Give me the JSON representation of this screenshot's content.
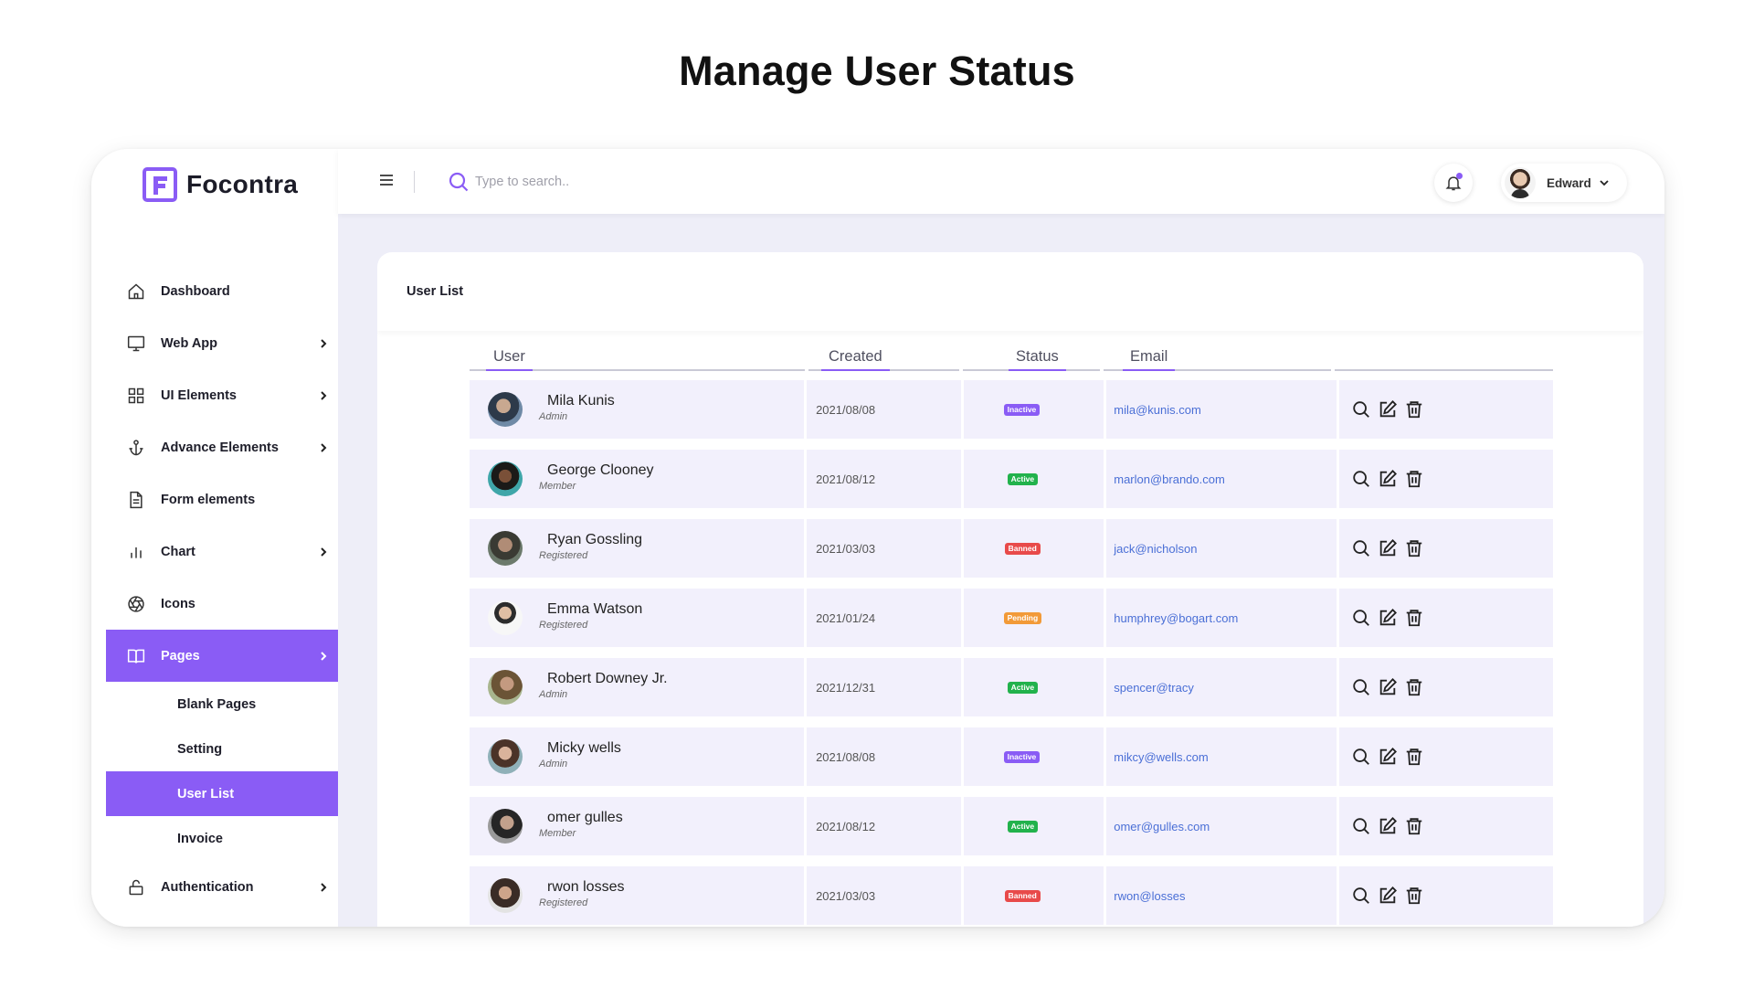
{
  "page_title": "Manage User Status",
  "brand": {
    "name": "Focontra"
  },
  "colors": {
    "accent": "#8a5cf5",
    "content_bg": "#eeeef8",
    "row_bg": "#f2f0fc",
    "link": "#4a6fd6"
  },
  "sidebar": {
    "items": [
      {
        "label": "Dashboard",
        "icon": "home-icon",
        "chevron": false
      },
      {
        "label": "Web App",
        "icon": "monitor-icon",
        "chevron": true
      },
      {
        "label": "UI Elements",
        "icon": "grid-icon",
        "chevron": true
      },
      {
        "label": "Advance Elements",
        "icon": "anchor-icon",
        "chevron": true
      },
      {
        "label": "Form elements",
        "icon": "document-icon",
        "chevron": false
      },
      {
        "label": "Chart",
        "icon": "bar-chart-icon",
        "chevron": true
      },
      {
        "label": "Icons",
        "icon": "aperture-icon",
        "chevron": false
      },
      {
        "label": "Pages",
        "icon": "book-icon",
        "chevron": true,
        "active": true
      }
    ],
    "sub_items": [
      {
        "label": "Blank Pages"
      },
      {
        "label": "Setting"
      },
      {
        "label": "User List",
        "active": true
      },
      {
        "label": "Invoice"
      }
    ],
    "bottom_item": {
      "label": "Authentication",
      "icon": "lock-icon",
      "chevron": true
    }
  },
  "topbar": {
    "search_placeholder": "Type to search..",
    "user_name": "Edward"
  },
  "card": {
    "title": "User List"
  },
  "table": {
    "headers": {
      "user": "User",
      "created": "Created",
      "status": "Status",
      "email": "Email"
    },
    "status_colors": {
      "Inactive": "#8a5cf5",
      "Active": "#22b24c",
      "Banned": "#e84a4a",
      "Pending": "#f29a38"
    },
    "rows": [
      {
        "name": "Mila Kunis",
        "role": "Admin",
        "created": "2021/08/08",
        "status": "Inactive",
        "email": "mila@kunis.com"
      },
      {
        "name": "George Clooney",
        "role": "Member",
        "created": "2021/08/12",
        "status": "Active",
        "email": "marlon@brando.com"
      },
      {
        "name": "Ryan Gossling",
        "role": "Registered",
        "created": "2021/03/03",
        "status": "Banned",
        "email": "jack@nicholson"
      },
      {
        "name": "Emma Watson",
        "role": "Registered",
        "created": "2021/01/24",
        "status": "Pending",
        "email": "humphrey@bogart.com"
      },
      {
        "name": "Robert Downey Jr.",
        "role": "Admin",
        "created": "2021/12/31",
        "status": "Active",
        "email": "spencer@tracy"
      },
      {
        "name": "Micky wells",
        "role": "Admin",
        "created": "2021/08/08",
        "status": "Inactive",
        "email": "mikcy@wells.com"
      },
      {
        "name": "omer gulles",
        "role": "Member",
        "created": "2021/08/12",
        "status": "Active",
        "email": "omer@gulles.com"
      },
      {
        "name": "rwon losses",
        "role": "Registered",
        "created": "2021/03/03",
        "status": "Banned",
        "email": "rwon@losses"
      }
    ]
  }
}
